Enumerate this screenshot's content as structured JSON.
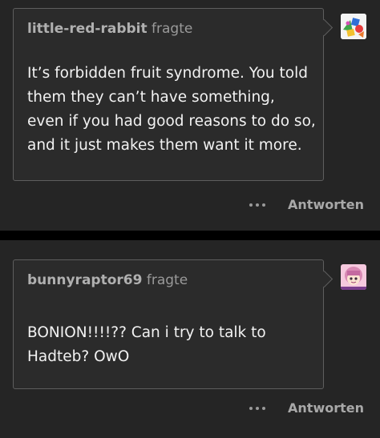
{
  "posts": [
    {
      "asker_name": "little-red-rabbit",
      "asker_verb": "fragte",
      "question": "It’s forbidden fruit syndrome. You told them they can’t have something, even if you had good reasons to do so, and it just makes them want it more.",
      "reply_label": "Antworten",
      "avatar_icon": "colorful-blocks-avatar"
    },
    {
      "asker_name": "bunnyraptor69",
      "asker_verb": "fragte",
      "question": "BONION!!!!?? Can i try to talk to Hadteb? OwO",
      "reply_label": "Antworten",
      "avatar_icon": "anime-character-avatar"
    }
  ],
  "colors": {
    "background": "#000000",
    "post_background": "#252525",
    "bubble_border": "#5e5e5e",
    "text": "#f2f2f2",
    "muted": "#a8a8a8"
  }
}
